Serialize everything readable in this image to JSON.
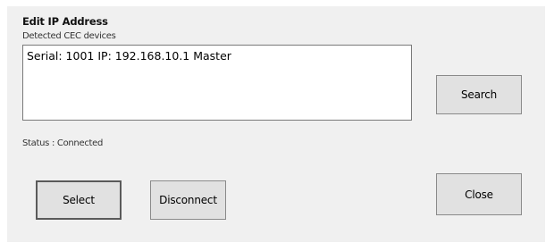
{
  "dialog": {
    "title": "Edit IP Address",
    "subtitle": "Detected CEC devices",
    "devices": [
      "Serial: 1001 IP: 192.168.10.1 Master"
    ],
    "status_text": "Status :  Connected"
  },
  "buttons": {
    "search": "Search",
    "select": "Select",
    "disconnect": "Disconnect",
    "close": "Close"
  }
}
